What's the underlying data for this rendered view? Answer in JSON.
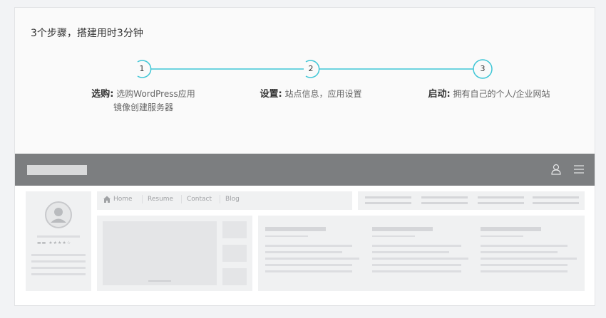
{
  "heading": "3个步骤，搭建用时3分钟",
  "steps": [
    {
      "num": "1",
      "title": "选购:",
      "desc_line1": "选购WordPress应用",
      "desc_line2": "镜像创建服务器"
    },
    {
      "num": "2",
      "title": "设置:",
      "desc_line1": "站点信息，应用设置",
      "desc_line2": ""
    },
    {
      "num": "3",
      "title": "启动:",
      "desc_line1": "拥有自己的个人/企业网站",
      "desc_line2": ""
    }
  ],
  "mock_nav": {
    "home": "Home",
    "resume": "Resume",
    "contact": "Contact",
    "blog": "Blog"
  },
  "colors": {
    "accent": "#3ec6d6",
    "bar": "#7c7e80",
    "panel": "#f0f1f2"
  },
  "icons": {
    "user": "user-icon",
    "menu": "menu-icon",
    "home": "home-icon",
    "avatar": "avatar-icon"
  }
}
